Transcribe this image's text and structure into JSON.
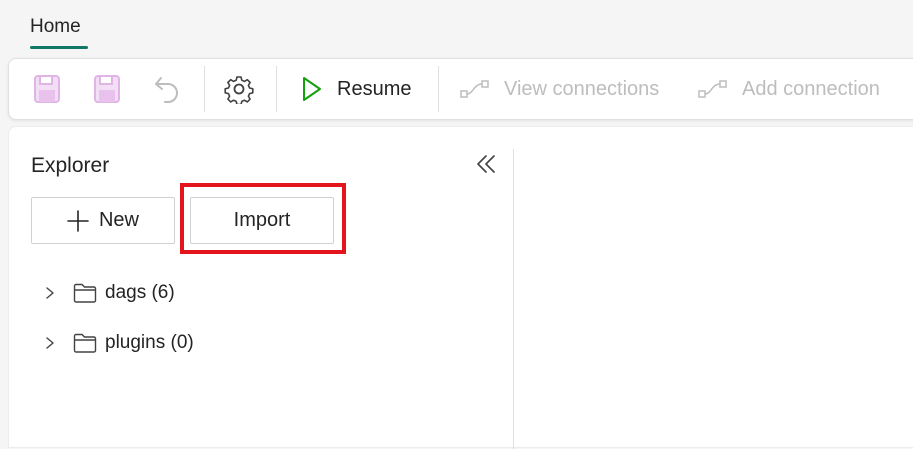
{
  "tabs": {
    "home_label": "Home"
  },
  "toolbar": {
    "resume_label": "Resume",
    "view_connections_label": "View connections",
    "add_connection_label": "Add connection"
  },
  "explorer": {
    "title": "Explorer",
    "new_label": "New",
    "import_label": "Import",
    "tree": [
      {
        "label": "dags (6)"
      },
      {
        "label": "plugins (0)"
      }
    ]
  },
  "colors": {
    "accent": "#117865",
    "resume_icon": "#13a10e",
    "save_icon": "#e8c2ec",
    "highlight_box": "#e3141b",
    "disabled_text": "#bdbdbd"
  }
}
